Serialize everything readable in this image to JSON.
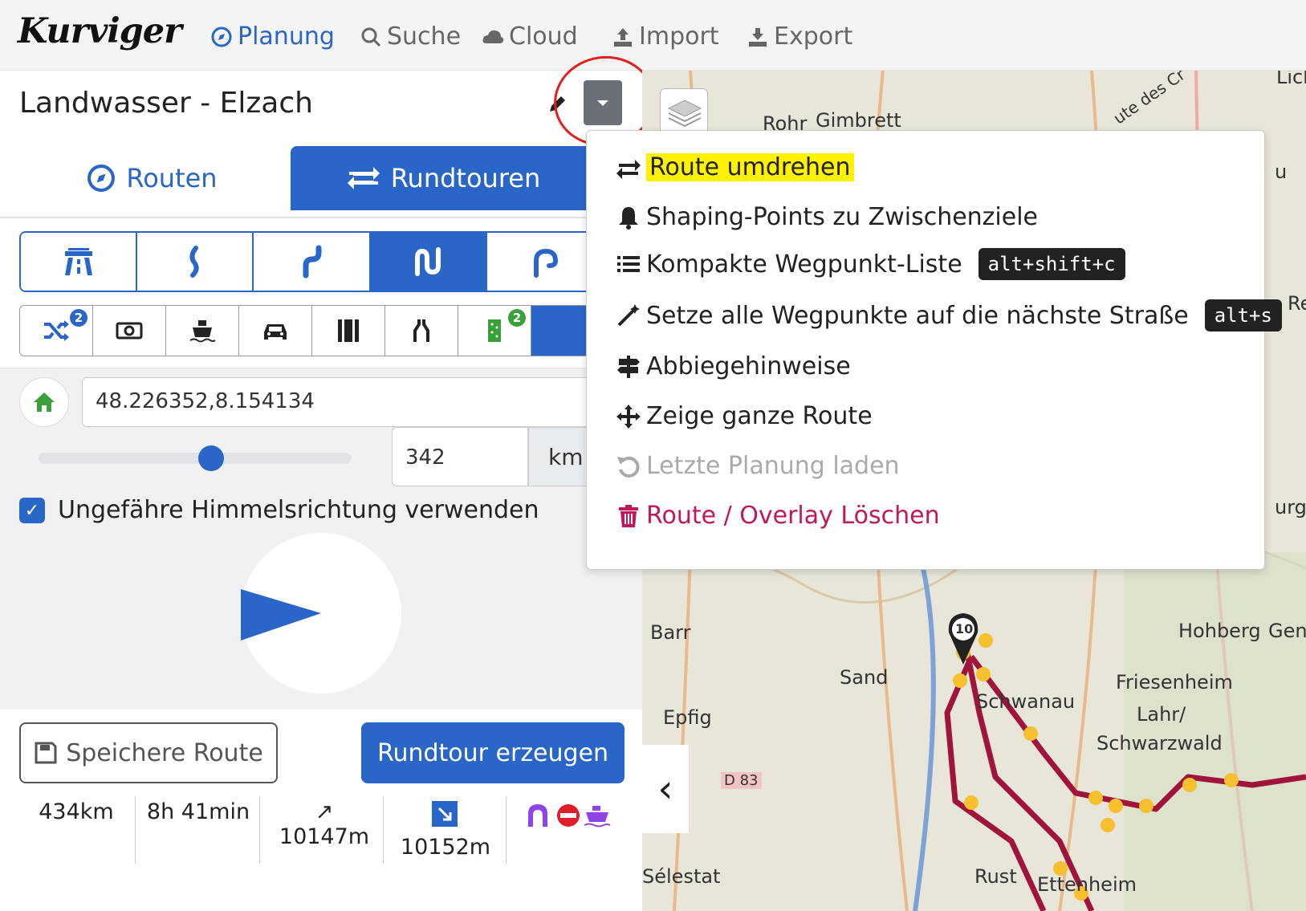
{
  "brand": "Kurviger",
  "nav": [
    {
      "label": "Planung",
      "icon": "compass-icon"
    },
    {
      "label": "Suche",
      "icon": "search-icon"
    },
    {
      "label": "Cloud",
      "icon": "cloud-icon"
    },
    {
      "label": "Import",
      "icon": "upload-icon"
    },
    {
      "label": "Export",
      "icon": "download-icon"
    }
  ],
  "route_title": "Landwasser - Elzach",
  "tabs": {
    "routen": "Routen",
    "rundtouren": "Rundtouren"
  },
  "curviness_selected": 3,
  "option_badges": {
    "shuffle": "2",
    "green": "2"
  },
  "start": {
    "value": "48.226352,8.154134"
  },
  "distance": {
    "value": "342",
    "unit": "km",
    "slider_fraction": 0.55
  },
  "direction_checkbox": {
    "label": "Ungefähre Himmelsrichtung verwenden",
    "checked": true
  },
  "buttons": {
    "save": "Speichere Route",
    "generate": "Rundtour erzeugen"
  },
  "stats": {
    "distance": "434km",
    "duration": "8h 41min",
    "ascent": "↗ 10147m",
    "descent": "10152m"
  },
  "menu": [
    {
      "label": "Route umdrehen",
      "icon": "swap-arrows-icon",
      "highlighted": true
    },
    {
      "label": "Shaping-Points zu Zwischenziele",
      "icon": "bell-icon"
    },
    {
      "label": "Kompakte Wegpunkt-Liste",
      "icon": "list-icon",
      "shortcut": "alt+shift+c"
    },
    {
      "label": "Setze alle Wegpunkte auf die nächste Straße",
      "icon": "magic-wand-icon",
      "shortcut": "alt+s"
    },
    {
      "label": "Abbiegehinweise",
      "icon": "signpost-icon"
    },
    {
      "label": "Zeige ganze Route",
      "icon": "move-arrows-icon"
    },
    {
      "label": "Letzte Planung laden",
      "icon": "undo-icon",
      "disabled": true
    },
    {
      "label": "Route / Overlay Löschen",
      "icon": "trash-icon",
      "danger": true
    }
  ],
  "map": {
    "labels": [
      "Rohr",
      "Gimbrett",
      "Barr",
      "Sand",
      "Epfig",
      "Schwanau",
      "Friesenheim",
      "Lahr/",
      "Schwarzwald",
      "Hohberg",
      "Gen",
      "Sélestat",
      "Rust",
      "Ettenheim",
      "D 83",
      "Lich",
      "u",
      "Re",
      "urg",
      "ute des Cr"
    ],
    "marker": "10"
  },
  "colors": {
    "accent": "#2a66c7",
    "danger": "#c0185d",
    "route": "#a0143c",
    "highlight": "#fff200"
  }
}
